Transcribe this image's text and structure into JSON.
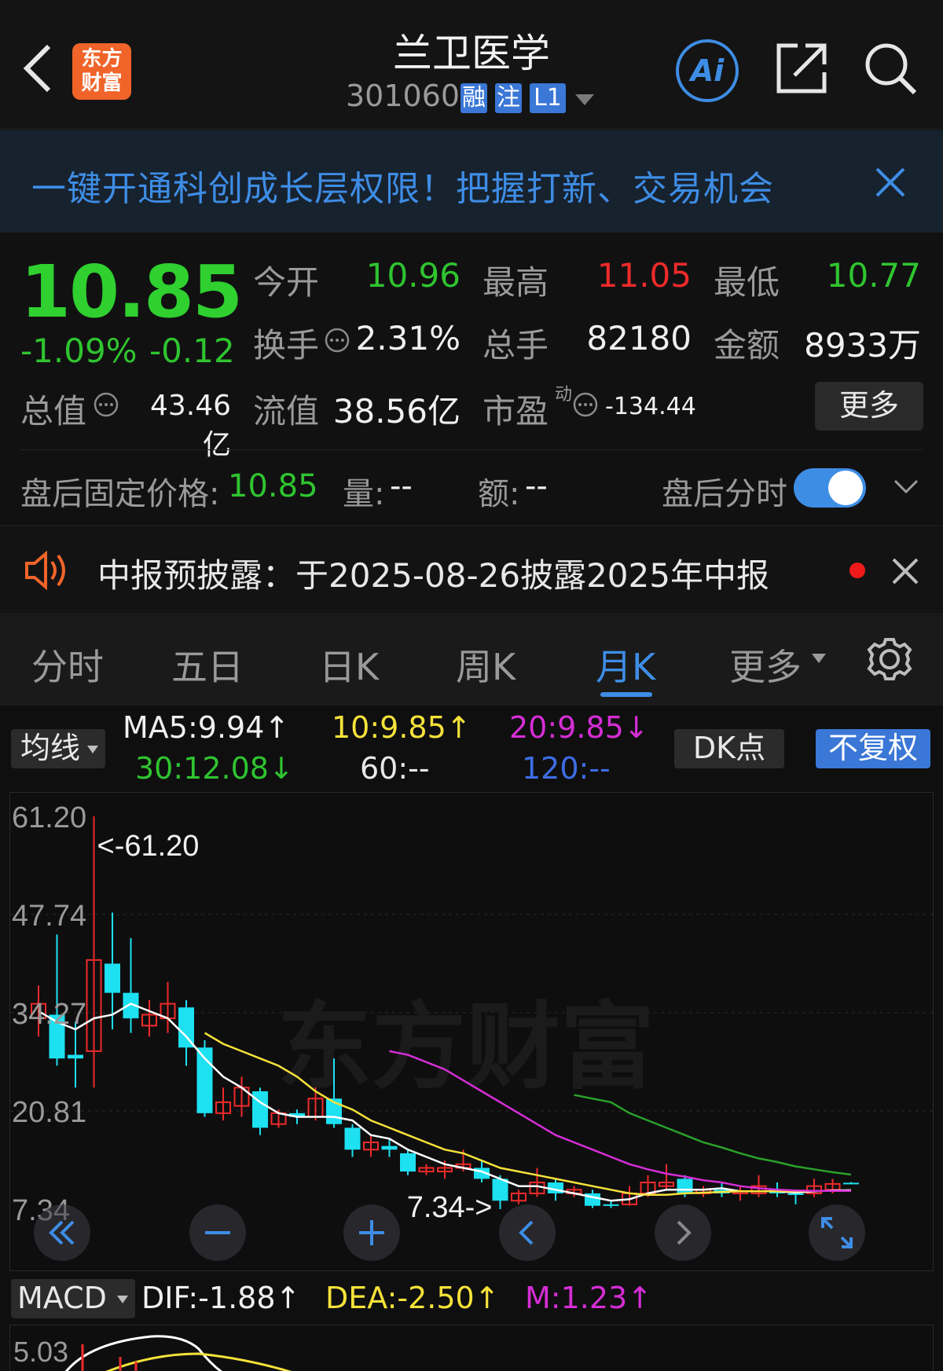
{
  "header": {
    "title": "兰卫医学",
    "code": "301060",
    "tags": [
      "融",
      "注",
      "L1"
    ],
    "logo_lines": [
      "东方",
      "财富"
    ],
    "ai_label": "Ai"
  },
  "banner": {
    "text": "一键开通科创成长层权限！把握打新、交易机会"
  },
  "quote": {
    "price": "10.85",
    "change_pct": "-1.09%",
    "change": "-0.12",
    "open_label": "今开",
    "open": "10.96",
    "high_label": "最高",
    "high": "11.05",
    "low_label": "最低",
    "low": "10.77",
    "turnover_label": "换手",
    "turnover": "2.31%",
    "volume_label": "总手",
    "volume": "82180",
    "amount_label": "金额",
    "amount": "8933万",
    "mktcap_label": "总值",
    "mktcap": "43.46亿",
    "float_label": "流值",
    "float": "38.56亿",
    "pe_label": "市盈",
    "pe_sup": "动",
    "pe": "-134.44",
    "more_label": "更多"
  },
  "afterhours": {
    "price_label": "盘后固定价格:",
    "price": "10.85",
    "vol_label": "量:",
    "vol": "--",
    "amt_label": "额:",
    "amt": "--",
    "timeshare_label": "盘后分时",
    "toggle_on": true
  },
  "notice": {
    "text": "中报预披露：于2025-08-26披露2025年中报"
  },
  "tabs": [
    {
      "label": "分时"
    },
    {
      "label": "五日"
    },
    {
      "label": "日K"
    },
    {
      "label": "周K"
    },
    {
      "label": "月K",
      "active": true
    },
    {
      "label": "更多"
    }
  ],
  "indicators": {
    "selector": "均线",
    "ma5": "MA5:9.94↑",
    "ma10": "10:9.85↑",
    "ma20": "20:9.85↓",
    "ma30": "30:12.08↓",
    "ma60": "60:--",
    "ma120": "120:--",
    "dk": "DK点",
    "rights": "不复权"
  },
  "chart_data": {
    "type": "candlestick",
    "y_ticks": [
      "61.20",
      "47.74",
      "34.27",
      "20.81",
      "7.34"
    ],
    "max_label": "<-61.20",
    "min_label": "7.34->",
    "watermark": "东方财富",
    "ylim": [
      7.34,
      61.2
    ],
    "candles": [
      {
        "o": 33.5,
        "c": 35.5,
        "h": 38.0,
        "l": 31.0
      },
      {
        "o": 34.0,
        "c": 28.0,
        "h": 45.0,
        "l": 27.0
      },
      {
        "o": 28.5,
        "c": 28.0,
        "h": 33.0,
        "l": 24.0
      },
      {
        "o": 29.0,
        "c": 41.5,
        "h": 61.2,
        "l": 24.0
      },
      {
        "o": 41.0,
        "c": 37.0,
        "h": 48.0,
        "l": 32.0
      },
      {
        "o": 37.0,
        "c": 33.5,
        "h": 44.5,
        "l": 31.5
      },
      {
        "o": 32.5,
        "c": 34.0,
        "h": 36.0,
        "l": 31.0
      },
      {
        "o": 33.5,
        "c": 35.5,
        "h": 38.5,
        "l": 31.5
      },
      {
        "o": 35.0,
        "c": 29.5,
        "h": 36.0,
        "l": 27.0
      },
      {
        "o": 29.5,
        "c": 20.5,
        "h": 30.5,
        "l": 20.0
      },
      {
        "o": 20.5,
        "c": 22.0,
        "h": 24.0,
        "l": 19.5
      },
      {
        "o": 21.5,
        "c": 24.0,
        "h": 25.5,
        "l": 20.0
      },
      {
        "o": 23.5,
        "c": 18.5,
        "h": 24.0,
        "l": 17.5
      },
      {
        "o": 19.0,
        "c": 20.5,
        "h": 21.0,
        "l": 18.5
      },
      {
        "o": 20.5,
        "c": 20.0,
        "h": 21.0,
        "l": 19.0
      },
      {
        "o": 20.0,
        "c": 22.5,
        "h": 24.0,
        "l": 19.5
      },
      {
        "o": 22.5,
        "c": 19.0,
        "h": 28.0,
        "l": 18.5
      },
      {
        "o": 18.5,
        "c": 15.5,
        "h": 19.0,
        "l": 14.5
      },
      {
        "o": 15.5,
        "c": 16.5,
        "h": 17.5,
        "l": 14.5
      },
      {
        "o": 16.0,
        "c": 15.5,
        "h": 17.0,
        "l": 14.5
      },
      {
        "o": 15.0,
        "c": 12.5,
        "h": 15.5,
        "l": 12.0
      },
      {
        "o": 12.5,
        "c": 13.0,
        "h": 13.5,
        "l": 12.0
      },
      {
        "o": 12.5,
        "c": 13.0,
        "h": 14.0,
        "l": 11.5
      },
      {
        "o": 13.0,
        "c": 13.5,
        "h": 15.5,
        "l": 12.5
      },
      {
        "o": 13.0,
        "c": 11.5,
        "h": 14.0,
        "l": 11.0
      },
      {
        "o": 11.5,
        "c": 8.5,
        "h": 12.0,
        "l": 7.34
      },
      {
        "o": 8.5,
        "c": 9.5,
        "h": 10.0,
        "l": 8.0
      },
      {
        "o": 9.5,
        "c": 11.0,
        "h": 13.0,
        "l": 9.0
      },
      {
        "o": 11.0,
        "c": 9.5,
        "h": 11.5,
        "l": 8.5
      },
      {
        "o": 9.5,
        "c": 10.0,
        "h": 10.5,
        "l": 9.0
      },
      {
        "o": 9.5,
        "c": 7.8,
        "h": 10.0,
        "l": 7.5
      },
      {
        "o": 8.0,
        "c": 7.8,
        "h": 8.5,
        "l": 7.5
      },
      {
        "o": 8.0,
        "c": 9.5,
        "h": 10.5,
        "l": 7.8
      },
      {
        "o": 9.5,
        "c": 11.0,
        "h": 12.0,
        "l": 9.0
      },
      {
        "o": 10.5,
        "c": 11.0,
        "h": 13.5,
        "l": 10.0
      },
      {
        "o": 11.5,
        "c": 9.5,
        "h": 12.0,
        "l": 9.0
      },
      {
        "o": 9.5,
        "c": 10.0,
        "h": 10.5,
        "l": 9.0
      },
      {
        "o": 10.0,
        "c": 9.5,
        "h": 11.0,
        "l": 9.0
      },
      {
        "o": 9.5,
        "c": 9.8,
        "h": 10.5,
        "l": 8.5
      },
      {
        "o": 9.5,
        "c": 10.5,
        "h": 12.0,
        "l": 9.0
      },
      {
        "o": 10.0,
        "c": 9.5,
        "h": 11.0,
        "l": 9.0
      },
      {
        "o": 9.5,
        "c": 9.3,
        "h": 10.0,
        "l": 8.0
      },
      {
        "o": 9.5,
        "c": 10.5,
        "h": 11.5,
        "l": 9.0
      },
      {
        "o": 10.0,
        "c": 10.8,
        "h": 11.5,
        "l": 9.5
      },
      {
        "o": 10.96,
        "c": 10.85,
        "h": 11.05,
        "l": 10.77
      }
    ],
    "ma5": [
      34.5,
      33.0,
      32.0,
      33.5,
      34.0,
      35.5,
      34.5,
      33.5,
      31.0,
      28.0,
      25.5,
      24.0,
      22.0,
      20.5,
      20.0,
      20.0,
      20.0,
      19.5,
      17.5,
      17.0,
      15.5,
      14.5,
      13.5,
      13.0,
      12.5,
      11.5,
      10.5,
      10.5,
      10.0,
      9.5,
      9.0,
      8.5,
      8.7,
      9.5,
      10.0,
      10.0,
      10.0,
      10.2,
      9.8,
      9.8,
      9.8,
      9.6,
      9.8,
      9.9,
      9.94
    ],
    "ma10": [
      null,
      null,
      null,
      null,
      null,
      null,
      null,
      null,
      null,
      31.5,
      30.0,
      29.0,
      28.0,
      27.0,
      25.5,
      23.5,
      22.0,
      21.0,
      19.5,
      18.5,
      17.5,
      16.5,
      15.5,
      15.0,
      14.0,
      13.0,
      12.5,
      12.0,
      11.5,
      11.0,
      10.5,
      10.0,
      9.5,
      9.3,
      9.3,
      9.5,
      9.6,
      9.7,
      9.8,
      9.8,
      9.8,
      9.8,
      9.85,
      9.85,
      9.85
    ],
    "ma20": [
      null,
      null,
      null,
      null,
      null,
      null,
      null,
      null,
      null,
      null,
      null,
      null,
      null,
      null,
      null,
      null,
      null,
      null,
      null,
      29.0,
      28.5,
      27.5,
      26.5,
      25.0,
      23.5,
      22.0,
      20.5,
      19.0,
      17.5,
      16.5,
      15.5,
      14.5,
      13.5,
      12.8,
      12.2,
      11.8,
      11.3,
      11.0,
      10.5,
      10.2,
      10.0,
      9.9,
      9.85,
      9.85,
      9.85
    ],
    "ma30": [
      null,
      null,
      null,
      null,
      null,
      null,
      null,
      null,
      null,
      null,
      null,
      null,
      null,
      null,
      null,
      null,
      null,
      null,
      null,
      null,
      null,
      null,
      null,
      null,
      null,
      null,
      null,
      null,
      null,
      23.0,
      22.5,
      22.0,
      20.5,
      19.5,
      18.5,
      17.5,
      16.5,
      15.8,
      15.0,
      14.3,
      13.8,
      13.2,
      12.8,
      12.4,
      12.08
    ]
  },
  "macd": {
    "selector": "MACD",
    "dif": "DIF:-1.88↑",
    "dea": "DEA:-2.50↑",
    "m": "M:1.23↑",
    "y_tick": "5.03"
  },
  "colors": {
    "up": "#ef2a2a",
    "down": "#1de0f0",
    "ma5": "#ffffff",
    "ma10": "#f5e23a",
    "ma20": "#d52ed5",
    "ma30": "#2aa12a",
    "accent": "#3e8de5"
  }
}
